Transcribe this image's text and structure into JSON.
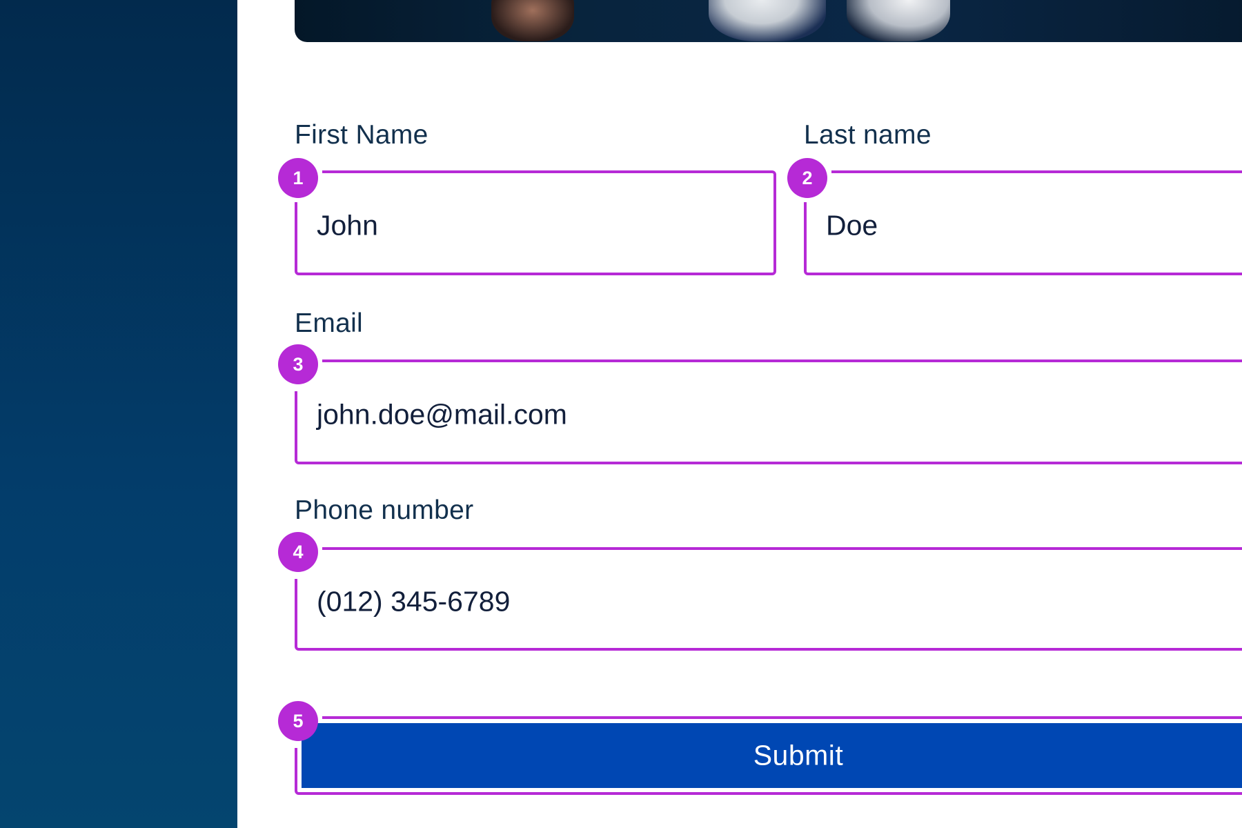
{
  "form": {
    "first_name": {
      "label": "First Name",
      "value": "John",
      "badge": "1"
    },
    "last_name": {
      "label": "Last name",
      "value": "Doe",
      "badge": "2"
    },
    "email": {
      "label": "Email",
      "value": "john.doe@mail.com",
      "badge": "3"
    },
    "phone": {
      "label": "Phone number",
      "value": "(012) 345-6789",
      "badge": "4"
    },
    "submit": {
      "label": "Submit",
      "badge": "5"
    }
  },
  "colors": {
    "sidebar": "#033d6b",
    "highlight": "#b62ad6",
    "button": "#0047b3",
    "label_text": "#12304d"
  }
}
